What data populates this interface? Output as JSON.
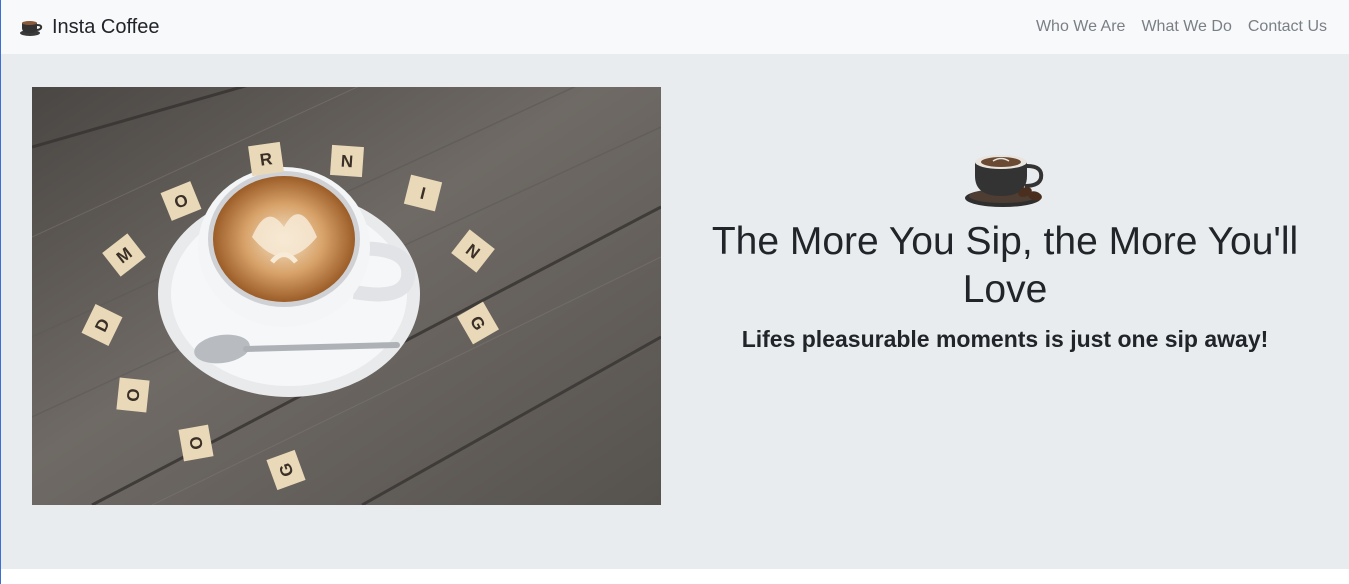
{
  "navbar": {
    "brand_icon": "coffee-cup-icon",
    "brand_text": "Insta Coffee",
    "links": [
      "Who We Are",
      "What We Do",
      "Contact Us"
    ]
  },
  "hero": {
    "image": "latte-art-cup-with-scrabble-tiles-spelling-good-morning",
    "tiles": [
      "R",
      "N",
      "I",
      "N",
      "G",
      "O",
      "M",
      "D",
      "O",
      "O",
      "G"
    ],
    "icon": "coffee-cup-with-beans-icon",
    "headline": "The More You Sip, the More You'll Love",
    "tagline": "Lifes pleasurable moments is just one sip away!"
  },
  "colors": {
    "navbar_bg": "#f8f9fa",
    "hero_bg": "#e9ecef",
    "text": "#212529",
    "nav_link": "#7a7f85"
  }
}
